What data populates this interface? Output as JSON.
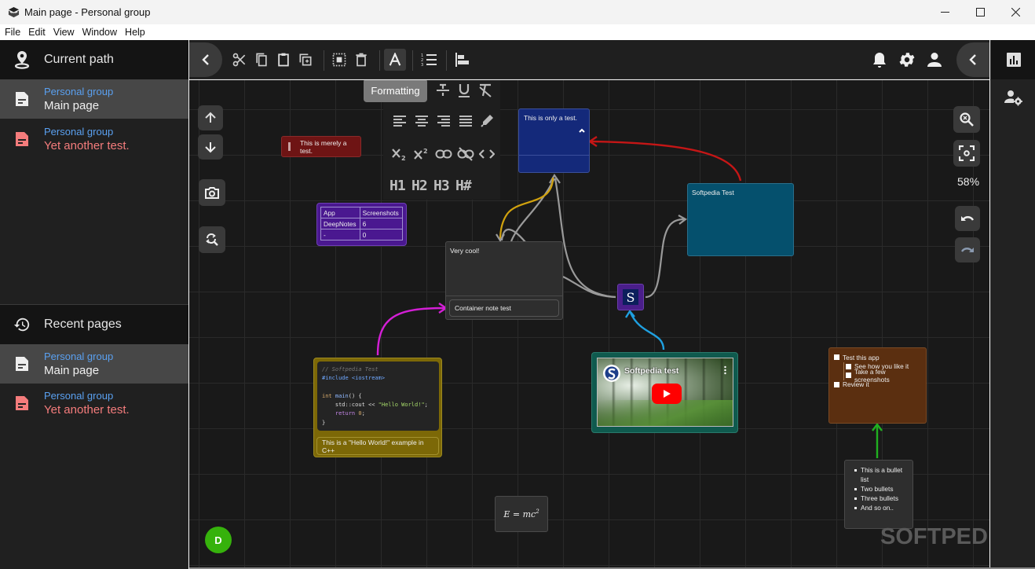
{
  "window": {
    "title": "Main page - Personal group",
    "controls": {
      "minimize": "minimize-icon",
      "maximize": "maximize-icon",
      "close": "close-icon"
    }
  },
  "menu": [
    "File",
    "Edit",
    "View",
    "Window",
    "Help"
  ],
  "left_sidebar": {
    "current_path": {
      "title": "Current path",
      "icon": "location-pin-icon",
      "items": [
        {
          "group": "Personal group",
          "page": "Main page",
          "active": true,
          "icon": "document-icon"
        },
        {
          "group": "Personal group",
          "page": "Yet another test.",
          "active": false,
          "icon": "document-icon",
          "color": "#f47c7c"
        }
      ]
    },
    "recent_pages": {
      "title": "Recent pages",
      "icon": "history-icon",
      "items": [
        {
          "group": "Personal group",
          "page": "Main page",
          "active": true,
          "icon": "document-icon"
        },
        {
          "group": "Personal group",
          "page": "Yet another test.",
          "active": false,
          "icon": "document-icon",
          "color": "#f47c7c"
        }
      ]
    }
  },
  "toolbar": {
    "left_buttons": [
      "collapse-left-icon",
      "cut-icon",
      "copy-icon",
      "paste-icon",
      "duplicate-icon",
      "select-all-icon",
      "delete-icon",
      "formatting-icon",
      "numbered-list-icon",
      "align-left-icon"
    ],
    "right_buttons": [
      "bell-icon",
      "gear-icon",
      "user-icon",
      "collapse-right-icon"
    ],
    "tooltip": "Formatting"
  },
  "formatting_panel": {
    "row1": [
      "strikethrough-icon",
      "underline-icon",
      "clear-format-icon"
    ],
    "row2": [
      "align-left-icon",
      "align-center-icon",
      "align-right-icon",
      "align-justify-icon",
      "highlight-pen-icon"
    ],
    "row3": [
      "subscript-icon",
      "superscript-icon",
      "link-icon",
      "unlink-icon",
      "code-icon"
    ],
    "headings": [
      "H1",
      "H2",
      "H3",
      "H#"
    ]
  },
  "canvas_controls": {
    "left": [
      "arrow-up-icon",
      "arrow-down-icon",
      "camera-icon",
      "find-replace-icon"
    ],
    "right": [
      "zoom-icon",
      "fit-screen-icon",
      "undo-icon",
      "redo-icon"
    ],
    "zoom_level": "58%"
  },
  "right_sidebar": [
    "bar-chart-icon",
    "user-settings-icon"
  ],
  "notes": {
    "red": {
      "text": "This is merely a test.",
      "color": "#6e1414"
    },
    "blue": {
      "text": "This is only a test.",
      "color": "#14297a"
    },
    "teal": {
      "text": "Softpedia Test",
      "color": "#05506d"
    },
    "table": {
      "color": "#4a1890",
      "headers": [
        "App",
        "Screenshots"
      ],
      "rows": [
        [
          "DeepNotes",
          "6"
        ],
        [
          "-",
          "0"
        ]
      ]
    },
    "container": {
      "title": "Very cool!",
      "child": "Container note test"
    },
    "code": {
      "color": "#7c6807",
      "lines": [
        "// Softpedia Test",
        "#include <iostream>",
        "",
        "int main() {",
        "    std::cout << \"Hello World!\";",
        "    return 0;",
        "}"
      ],
      "caption": "This is a \"Hello World!\" example in C++"
    },
    "logo": {
      "letter": "S"
    },
    "video": {
      "title": "Softpedia test"
    },
    "checklist": {
      "color": "#5b2f10",
      "items": [
        {
          "label": "Test this app",
          "level": 0,
          "checked": false
        },
        {
          "label": "See how you like it",
          "level": 1,
          "checked": false
        },
        {
          "label": "Take a few screenshots",
          "level": 1,
          "checked": false
        },
        {
          "label": "Review it",
          "level": 0,
          "checked": false
        }
      ]
    },
    "bullets": {
      "items": [
        "This is a bullet list",
        "Two bullets",
        "Three bullets",
        "And so on.."
      ]
    },
    "math": {
      "base": "E = mc",
      "exp": "2"
    }
  },
  "avatar": {
    "initial": "D",
    "color": "#36b20c"
  },
  "watermark": "SOFTPEDIA"
}
